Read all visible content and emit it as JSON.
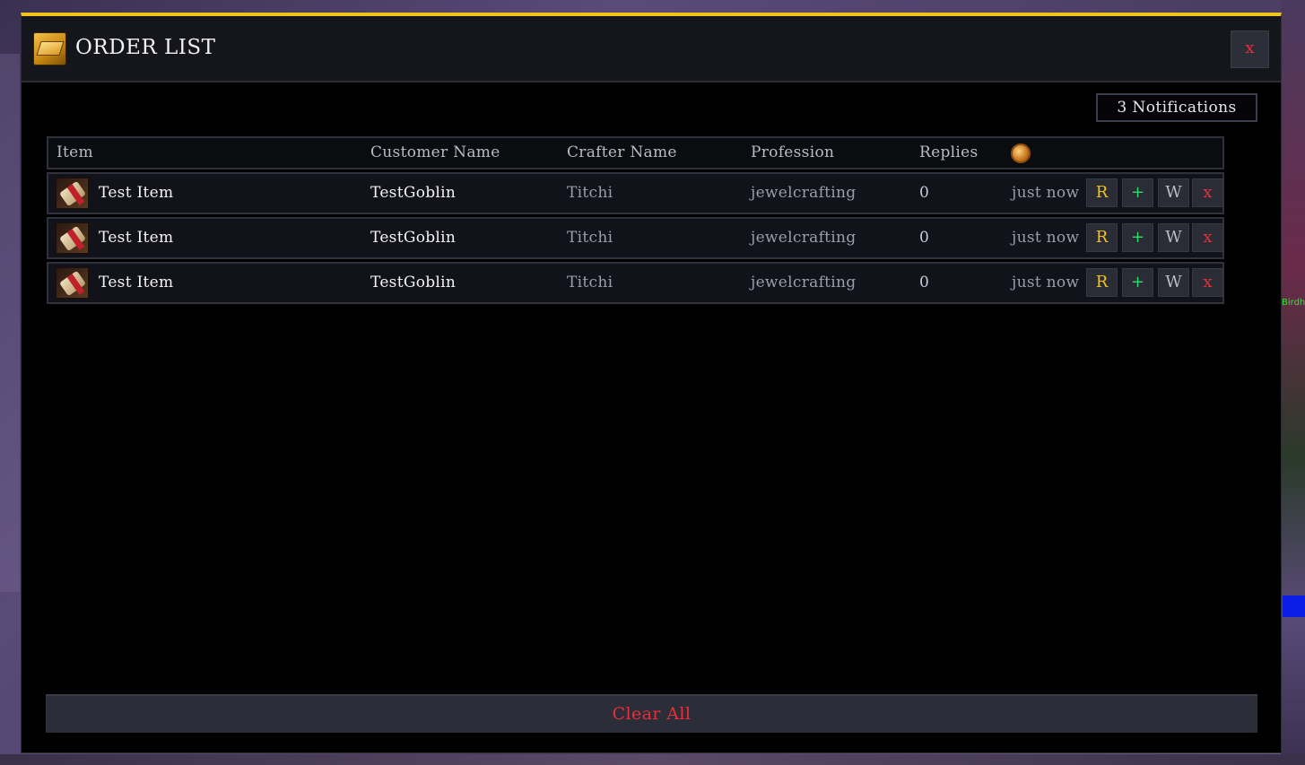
{
  "window": {
    "title": "ORDER LIST",
    "title_icon": "letter-icon",
    "close_label": "x",
    "accent_color": "#f2c21a"
  },
  "notifications": {
    "label": "3 Notifications"
  },
  "table": {
    "headers": {
      "item": "Item",
      "customer": "Customer Name",
      "crafter": "Crafter Name",
      "profession": "Profession",
      "replies": "Replies",
      "time_icon": "clock-icon"
    },
    "rows": [
      {
        "item": "Test Item",
        "item_icon": "scroll-icon",
        "customer": "TestGoblin",
        "crafter": "Titchi",
        "profession": "jewelcrafting",
        "replies": "0",
        "time": "just now"
      },
      {
        "item": "Test Item",
        "item_icon": "scroll-icon",
        "customer": "TestGoblin",
        "crafter": "Titchi",
        "profession": "jewelcrafting",
        "replies": "0",
        "time": "just now"
      },
      {
        "item": "Test Item",
        "item_icon": "scroll-icon",
        "customer": "TestGoblin",
        "crafter": "Titchi",
        "profession": "jewelcrafting",
        "replies": "0",
        "time": "just now"
      }
    ],
    "actions": {
      "reply": "R",
      "add": "+",
      "whisper": "W",
      "remove": "x"
    }
  },
  "footer": {
    "clear_label": "Clear All"
  },
  "background": {
    "edge_text": "Birdh ogrif"
  }
}
